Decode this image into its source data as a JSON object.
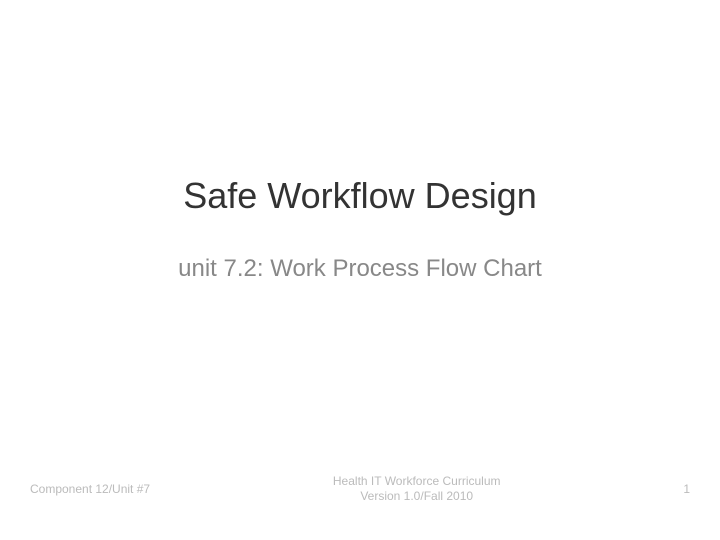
{
  "slide": {
    "title": "Safe Workflow Design",
    "subtitle": "unit 7.2: Work Process Flow Chart"
  },
  "footer": {
    "left": "Component 12/Unit #7",
    "center_line1": "Health IT Workforce Curriculum",
    "center_line2": "Version 1.0/Fall 2010",
    "right": "1"
  }
}
